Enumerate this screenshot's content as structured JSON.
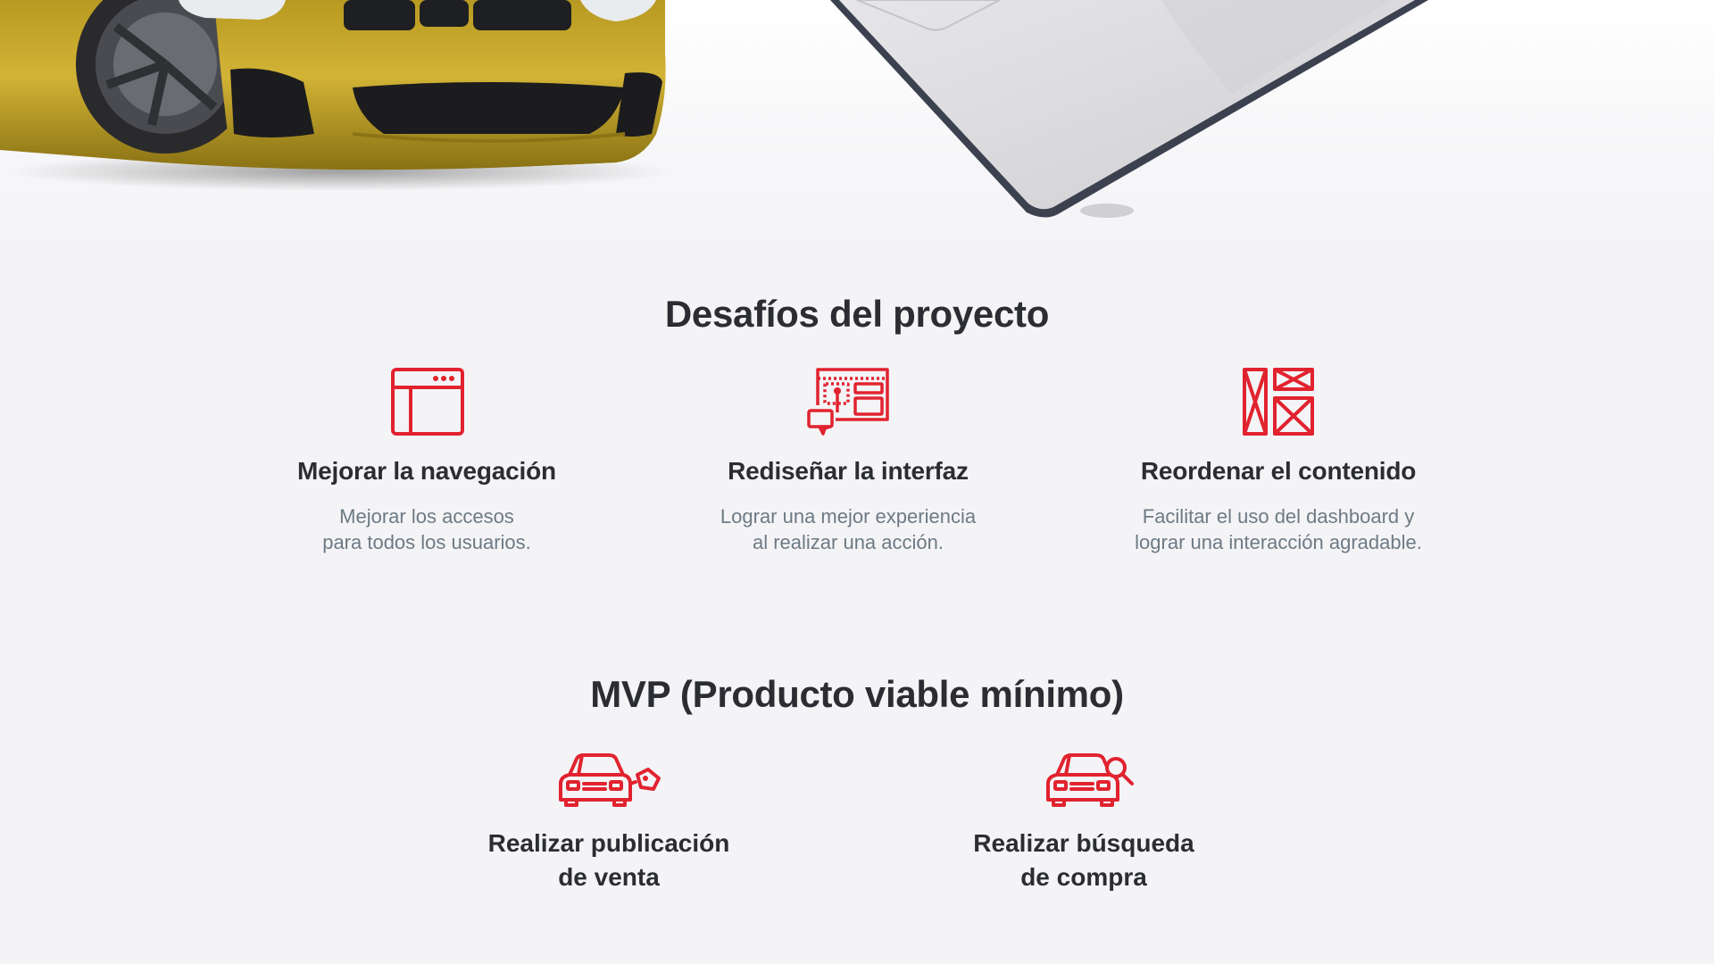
{
  "colors": {
    "accent": "#e1232f",
    "heading": "#2b2d33",
    "body_text": "#6d7a84",
    "background": "#f4f4f6",
    "car_body": "#c9a82a",
    "laptop_body": "#d9d9dc"
  },
  "hero": {
    "car_image": "yellow-sports-car-front",
    "laptop_image": "silver-laptop-corner"
  },
  "challenges": {
    "title": "Desafíos del proyecto",
    "items": [
      {
        "icon": "browser-window-icon",
        "title": "Mejorar la navegación",
        "desc_line1": "Mejorar los accesos",
        "desc_line2": "para todos los usuarios."
      },
      {
        "icon": "interface-design-icon",
        "title": "Rediseñar la interfaz",
        "desc_line1": "Lograr una mejor experiencia",
        "desc_line2": "al realizar una acción."
      },
      {
        "icon": "wireframe-layout-icon",
        "title": "Reordenar el contenido",
        "desc_line1": "Facilitar el uso del dashboard y",
        "desc_line2": "lograr una interacción agradable."
      }
    ]
  },
  "mvp": {
    "title": "MVP (Producto viable mínimo)",
    "items": [
      {
        "icon": "car-price-tag-icon",
        "title_line1": "Realizar publicación",
        "title_line2": "de venta"
      },
      {
        "icon": "car-search-icon",
        "title_line1": "Realizar búsqueda",
        "title_line2": "de compra"
      }
    ]
  }
}
